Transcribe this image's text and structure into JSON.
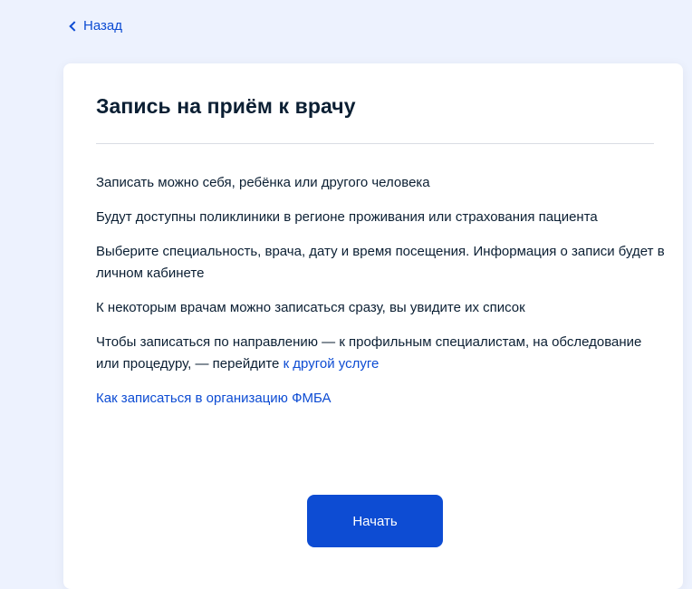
{
  "nav": {
    "back_label": "Назад"
  },
  "card": {
    "title": "Запись на приём к врачу",
    "p1": "Записать можно себя, ребёнка или другого человека",
    "p2": "Будут доступны поликлиники в регионе проживания или страхования пациента",
    "p3": "Выберите специальность, врача, дату и время посещения. Информация о записи будет в личном кабинете",
    "p4": "К некоторым врачам можно записаться сразу, вы увидите их список",
    "p5_text": "Чтобы записаться по направлению — к профильным специалистам, на обследование или процедуру, — перейдите ",
    "p5_link": "к другой услуге",
    "fmba_link": "Как записаться в организацию ФМБА",
    "start_button": "Начать"
  },
  "colors": {
    "background": "#edf2fe",
    "card": "#ffffff",
    "accent": "#0d4cd3",
    "text": "#0b1f33",
    "divider": "#d9dde4"
  },
  "icons": {
    "back": "chevron-left-icon"
  }
}
